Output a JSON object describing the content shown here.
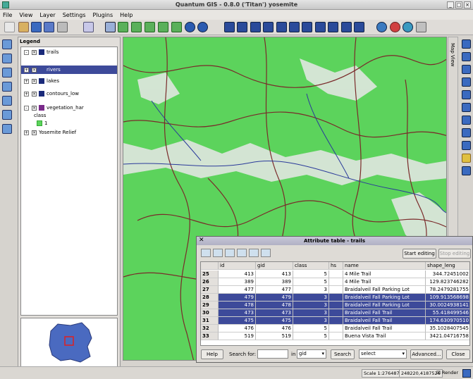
{
  "window": {
    "title": "Quantum GIS - 0.8.0 ('Titan') yosemite"
  },
  "menu": [
    "File",
    "View",
    "Layer",
    "Settings",
    "Plugins",
    "Help"
  ],
  "legend": {
    "title": "Legend",
    "layers": [
      {
        "label": "trails",
        "selected": false
      },
      {
        "label": "rivers",
        "selected": true
      },
      {
        "label": "lakes",
        "selected": false
      },
      {
        "label": "contours_low",
        "selected": false
      },
      {
        "label": "vegetation_har",
        "selected": false
      },
      {
        "label": "class",
        "selected": false
      },
      {
        "label": "1",
        "selected": false
      },
      {
        "label": "Yosemite Relief",
        "selected": false
      }
    ]
  },
  "map_tab": "Map View",
  "attribute_table": {
    "title": "Attribute table - trails",
    "start_editing": "Start editing",
    "stop_editing": "Stop editing",
    "columns": [
      "id",
      "gid",
      "class",
      "hs",
      "name",
      "shape_leng"
    ],
    "rows": [
      {
        "row": "25",
        "cells": [
          "413",
          "413",
          "5",
          "4 Mile Trail",
          "344.72451002"
        ],
        "selected": false
      },
      {
        "row": "26",
        "cells": [
          "389",
          "389",
          "5",
          "4 Mile Trail",
          "129.823746282"
        ],
        "selected": false
      },
      {
        "row": "27",
        "cells": [
          "477",
          "477",
          "3",
          "Braidalveil Fall Parking Lot",
          "78.2479281755"
        ],
        "selected": false
      },
      {
        "row": "28",
        "cells": [
          "479",
          "479",
          "3",
          "Braidalveil Fall Parking Lot",
          "109.913568698"
        ],
        "selected": true
      },
      {
        "row": "29",
        "cells": [
          "478",
          "478",
          "3",
          "Braidalveil Fall Parking Lot",
          "30.0024938141"
        ],
        "selected": true
      },
      {
        "row": "30",
        "cells": [
          "473",
          "473",
          "3",
          "Braidalveil Fall Trail",
          "55.418499546"
        ],
        "selected": true
      },
      {
        "row": "31",
        "cells": [
          "475",
          "475",
          "3",
          "Braidalveil Fall Trail",
          "174.630970510"
        ],
        "selected": true
      },
      {
        "row": "32",
        "cells": [
          "476",
          "476",
          "5",
          "Braidalveil Fall Trail",
          "35.1028407545"
        ],
        "selected": false
      },
      {
        "row": "33",
        "cells": [
          "519",
          "519",
          "5",
          "Buena Vista Trail",
          "3421.04716758"
        ],
        "selected": false
      }
    ],
    "help": "Help",
    "search_for": "Search for:",
    "search_value": "",
    "in": "in",
    "search_column": "gid",
    "search": "Search",
    "select_option": "select",
    "advanced": "Advanced...",
    "close": "Close"
  },
  "status": {
    "scale": "Scale 1:276487",
    "coords": "248220,4187526",
    "render": "Render"
  }
}
